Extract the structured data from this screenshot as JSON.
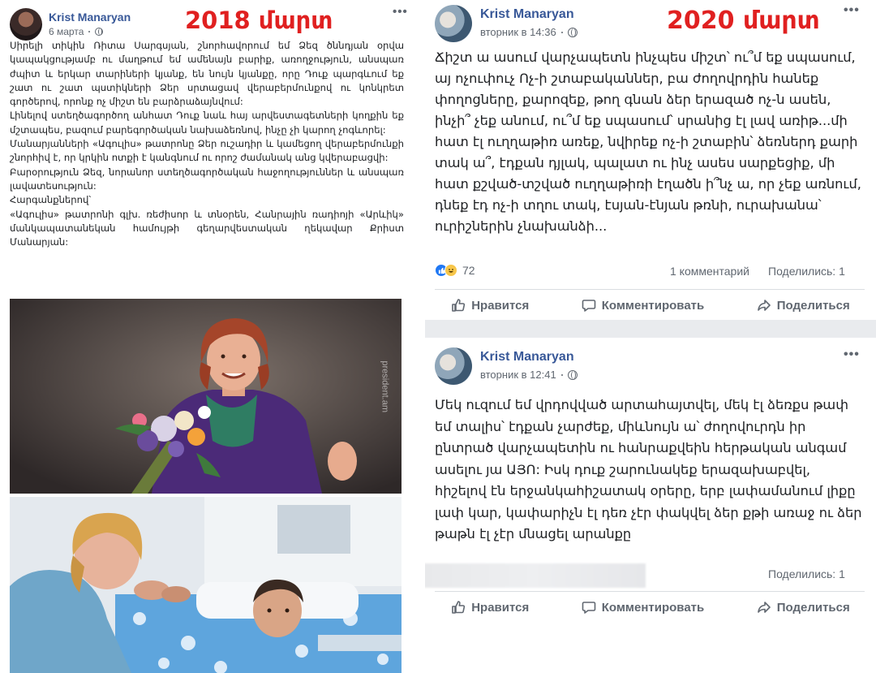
{
  "left_post": {
    "author": "Krist Manaryan",
    "time": "6 марта",
    "year_label": "2018 մարտ",
    "menu_icon": "more-dots-icon",
    "paragraphs": [
      "Սիրելի տիկին Ռիտա Սարգսյան, շնորհավորում եմ Ձեզ ծննդյան օրվա կապակցությամբ ու մաղթում եմ ամենայն բարիք, առողջություն, անսպառ ժպիտ և երկար տարիների կյանք, են նույն կյանքը, որը Դուք պարգևում եք շատ ու շատ պստիկների Ձեր սրտացավ վերաբերմունքով ու կոնկրետ գործերով, որոնք ոչ միշտ են բարձրաձայնվում:",
      "Լինելով ստեղծագործող անհատ Դուք նաև հայ արվեստագետների կողքին եք մշտապես, բազում բարեգործական նախաձեռնով, ինչը չի կարող չոգևորել:",
      "Մանարյանների «Ագուլիս» թատրոնը Ձեր ուշադիր և կամեցող վերաբերմունքի շնորհիվ է, որ կրկին ոտքի է կանգնում ու որոշ ժամանակ անց կվերաբացվի:",
      "Բարօրություն Ձեզ, նորանոր ստեղծագործական հաջողություններ և անսպառ լավատեսություն:",
      "Հարգանքներով՝",
      "«Ագուլիս» թատրոնի գլխ. ռեժիսոր և տնօրեն, Հանրային ռադիոյի «Արևիկ» մանկապատանեկան համույթի գեղարվեստական ղեկավար Քրիստ Մանարյան:"
    ],
    "photo_watermark": "president.am"
  },
  "right_post_1": {
    "author": "Krist Manaryan",
    "time": "вторник в 14:36",
    "year_label": "2020 մարտ",
    "menu_icon": "more-dots-icon",
    "text": "Ճիշտ ա ասում վարչապետն ինչպես միշտ՝ ու՞մ եք սպասում, այ ոչուփուչ Ոչ-ի շտաբականներ, բա ժողովրդին հանեք փողոցները, քարոզեք, թող գնան ձեր երազած ոչ-ն ասեն, ինչի՞ չեք անում, ու՞մ եք սպասում՝ սրանից էլ լավ առիթ...մի հատ էլ ուղղաթիռ առեք, նվիրեք ոչ-ի շտաբին՝ ձեռներդ քարի տակ ա՞, էդքան դյլակ, պալատ ու ինչ ասես սարքեցիք, մի հատ քշված-տշված ուղղաթիռի էղածն ի՞նչ ա, որ չեք առնում, դնեք էդ ոչ-ի տղու տակ, էսյան-էնյան թռնի, ուրախանա՝ ուրիշներին չնախանձի...",
    "reactions_count": "72",
    "comments_text": "1 комментарий",
    "shares_text": "Поделились: 1",
    "actions": {
      "like": "Нравится",
      "comment": "Комментировать",
      "share": "Поделиться"
    }
  },
  "right_post_2": {
    "author": "Krist Manaryan",
    "time": "вторник в 12:41",
    "menu_icon": "more-dots-icon",
    "text": "Մեկ ուզում եմ վրդովված արտահայտվել, մեկ էլ ձեռքս թափ եմ տալիս՝ էդքան չարժեք, միևնույն ա՝ ժողովուրդն իր ընտրած վարչապետին ու հանրաքվեին հերթական անգամ ասելու յա ԱՅՈ: Իսկ դուք շարունակեք երազախաբվել, հիշելով էն երջանկահիշատակ օրերը, երբ լափամանում լիքը լափ կար, կափարիչն էլ դեռ չէր փակվել ձեր քթի առաջ ու ձեր թաթն էլ չէր մնացել արանքը",
    "shares_text": "Поделились: 1",
    "actions": {
      "like": "Нравится",
      "comment": "Комментировать",
      "share": "Поделиться"
    }
  },
  "colors": {
    "fb_blue": "#385898",
    "red_label": "#e02020",
    "muted": "#606770",
    "divider": "#dadde1"
  }
}
